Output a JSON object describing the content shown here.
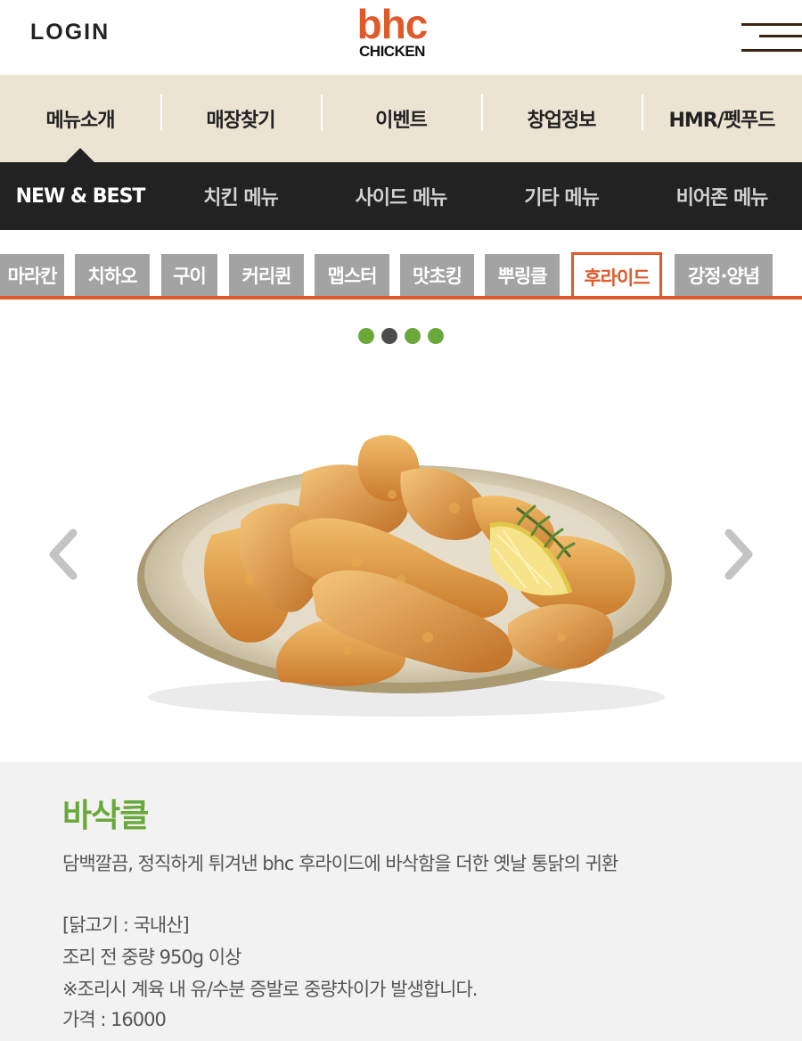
{
  "header": {
    "login_label": "LOGIN",
    "logo_top": "bhc",
    "logo_bottom": "CHICKEN"
  },
  "main_nav": {
    "items": [
      {
        "label": "메뉴소개",
        "active": true
      },
      {
        "label": "매장찾기"
      },
      {
        "label": "이벤트"
      },
      {
        "label": "창업정보"
      },
      {
        "label": "HMR/펫푸드"
      }
    ]
  },
  "sub_nav": {
    "items": [
      {
        "label": "NEW & BEST",
        "active": true
      },
      {
        "label": "치킨 메뉴"
      },
      {
        "label": "사이드 메뉴"
      },
      {
        "label": "기타 메뉴"
      },
      {
        "label": "비어존 메뉴"
      }
    ]
  },
  "category_tabs": {
    "items": [
      {
        "label": "마라칸"
      },
      {
        "label": "치하오"
      },
      {
        "label": "구이"
      },
      {
        "label": "커리퀸"
      },
      {
        "label": "맵스터"
      },
      {
        "label": "맛초킹"
      },
      {
        "label": "뿌링클"
      },
      {
        "label": "후라이드",
        "active": true
      },
      {
        "label": "강정·양념"
      }
    ]
  },
  "slider": {
    "dot_count": 4,
    "current_index": 1
  },
  "product": {
    "name": "바삭클",
    "description": "담백깔끔, 정직하게 튀겨낸 bhc 후라이드에 바삭함을 더한 옛날 통닭의 귀환",
    "origin": "[닭고기 : 국내산]",
    "weight": "조리 전 중량 950g 이상",
    "note": "※조리시 계육 내 유/수분 증발로 중량차이가 발생합니다.",
    "price": "가격 : 16000"
  },
  "colors": {
    "brand_orange": "#e0592a",
    "name_green": "#6aa83a",
    "nav_beige": "#ece4d2",
    "subnav_dark": "#222222",
    "tab_gray": "#a3a3a3"
  },
  "icons": {
    "menu": "hamburger-icon",
    "prev": "chevron-left-icon",
    "next": "chevron-right-icon"
  }
}
